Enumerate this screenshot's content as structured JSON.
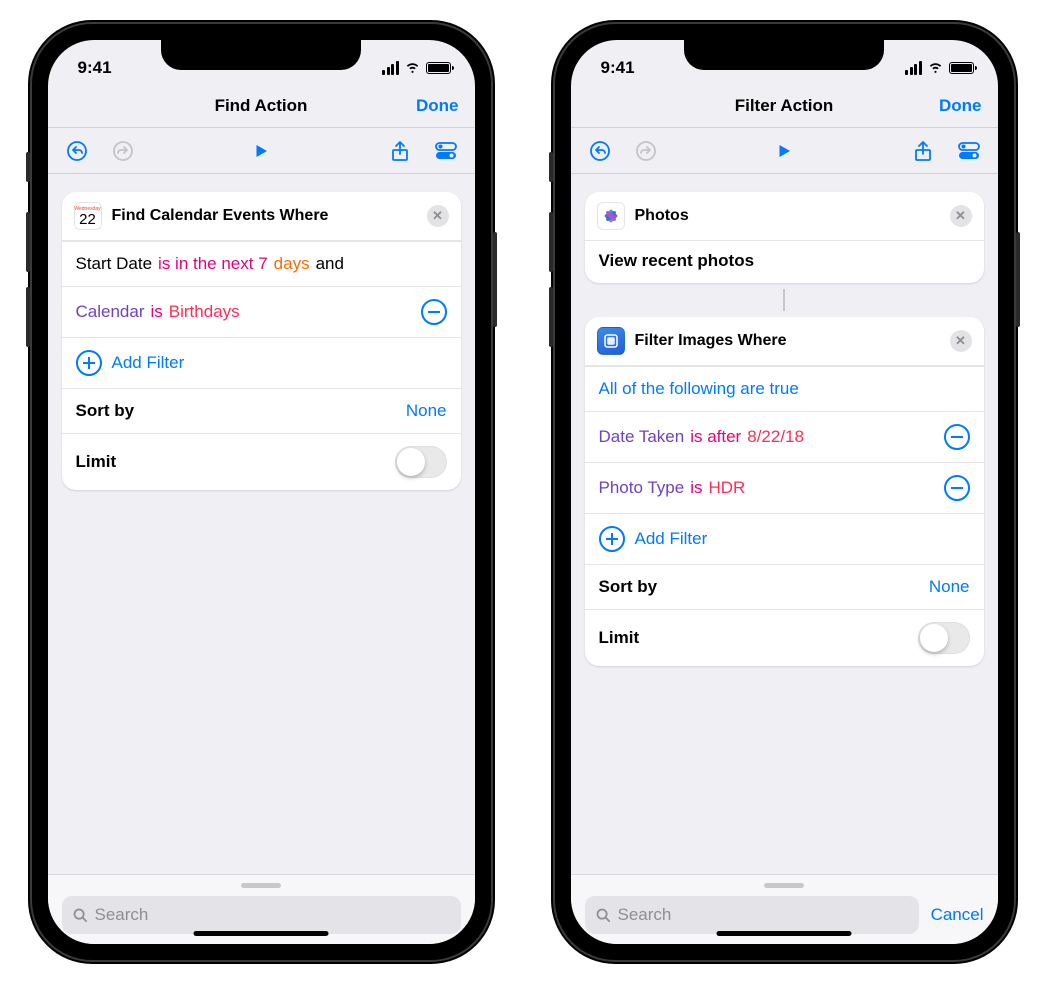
{
  "status": {
    "time": "9:41"
  },
  "left": {
    "nav_title": "Find Action",
    "done": "Done",
    "card": {
      "title": "Find Calendar Events Where",
      "cal_weekday": "Wednesday",
      "cal_day": "22",
      "r1_startdate": "Start Date",
      "r1_pred": "is in the next 7",
      "r1_unit": "days",
      "r1_and": "and",
      "r2_field": "Calendar",
      "r2_is": "is",
      "r2_val": "Birthdays",
      "add_filter": "Add Filter",
      "sort_label": "Sort by",
      "sort_value": "None",
      "limit_label": "Limit"
    },
    "search_placeholder": "Search"
  },
  "right": {
    "nav_title": "Filter Action",
    "done": "Done",
    "photos_card": {
      "title": "Photos",
      "sub": "View recent photos"
    },
    "filter_card": {
      "title": "Filter Images Where",
      "cond": "All of the following are true",
      "r1_field": "Date Taken",
      "r1_pred": "is after",
      "r1_val": "8/22/18",
      "r2_field": "Photo Type",
      "r2_is": "is",
      "r2_val": "HDR",
      "add_filter": "Add Filter",
      "sort_label": "Sort by",
      "sort_value": "None",
      "limit_label": "Limit"
    },
    "search_placeholder": "Search",
    "cancel": "Cancel"
  }
}
